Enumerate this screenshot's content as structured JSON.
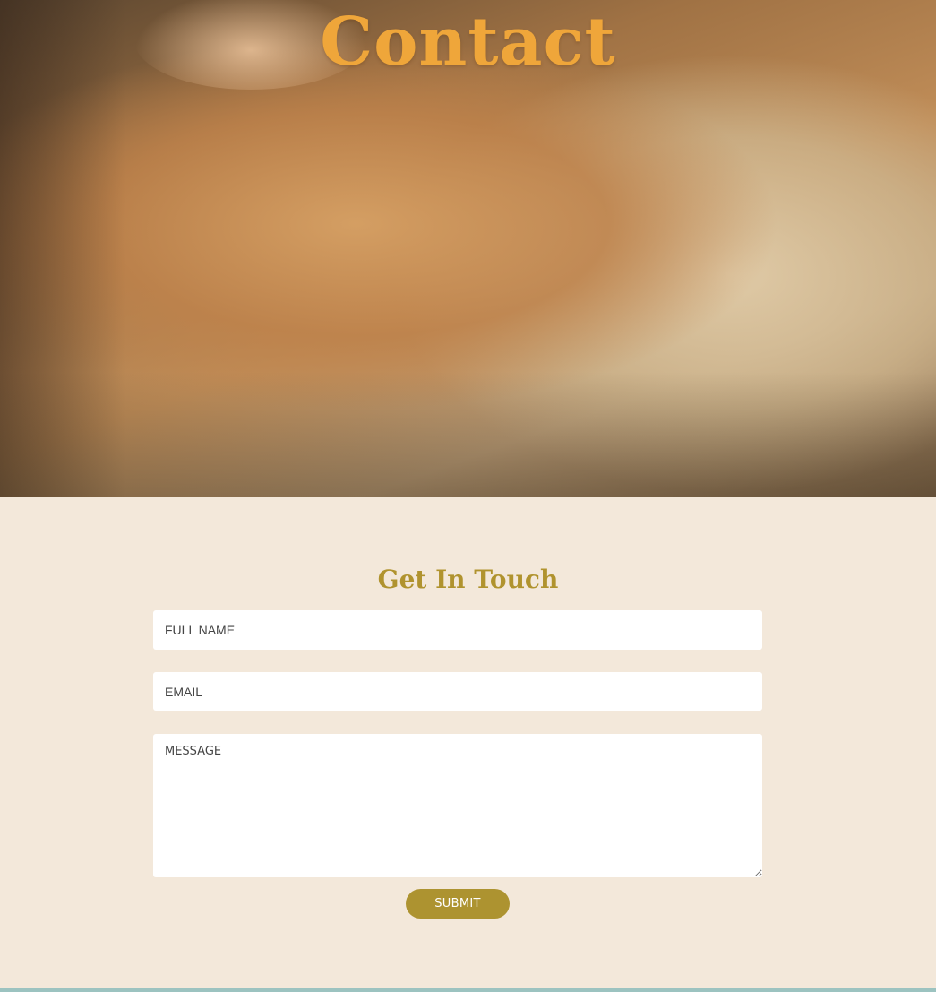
{
  "hero": {
    "title": "Contact",
    "image_description_icon": "massage-photo"
  },
  "contact": {
    "heading": "Get In Touch",
    "fields": {
      "full_name_placeholder": "FULL NAME",
      "full_name_value": "",
      "email_placeholder": "EMAIL",
      "email_value": "",
      "message_placeholder": "MESSAGE",
      "message_value": ""
    },
    "submit_label": "SUBMIT"
  },
  "colors": {
    "hero_title": "#efa63a",
    "heading": "#b0932e",
    "button": "#ad9330",
    "section_bg": "#f3e8da",
    "footer_strip": "#9cc3c0"
  }
}
